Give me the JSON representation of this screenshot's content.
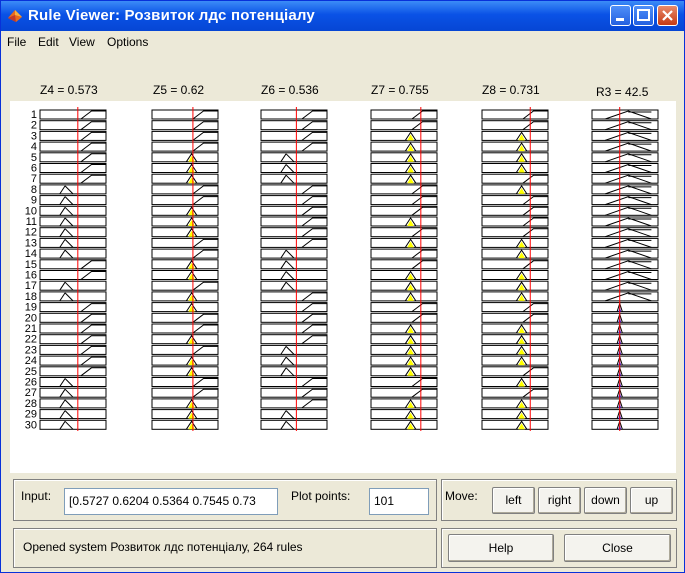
{
  "window": {
    "title": "Rule Viewer: Розвиток лдс потенціалу",
    "accent": "#0a52e6"
  },
  "menu": {
    "items": [
      "File",
      "Edit",
      "View",
      "Options"
    ]
  },
  "variables": [
    {
      "label": "Z4 = 0.573",
      "value": 0.573
    },
    {
      "label": "Z5 = 0.62",
      "value": 0.62
    },
    {
      "label": "Z6 = 0.536",
      "value": 0.536
    },
    {
      "label": "Z7 = 0.755",
      "value": 0.755
    },
    {
      "label": "Z8 = 0.731",
      "value": 0.731
    },
    {
      "label": "R3 = 42.5",
      "value": 42.5
    }
  ],
  "rule_numbers": [
    "1",
    "2",
    "3",
    "4",
    "5",
    "6",
    "7",
    "8",
    "9",
    "10",
    "11",
    "12",
    "13",
    "14",
    "15",
    "16",
    "17",
    "18",
    "19",
    "20",
    "21",
    "22",
    "23",
    "24",
    "25",
    "26",
    "27",
    "28",
    "29",
    "30"
  ],
  "rules": {
    "comment": "membership function per cell: R=ramp-right, L=ramp-left, T=triangle, N=narrow-triangle, W=wide-triangle",
    "Z4": [
      "R",
      "R",
      "R",
      "R",
      "R",
      "R",
      "R",
      "L",
      "L",
      "L",
      "L",
      "L",
      "L",
      "L",
      "R",
      "R",
      "L",
      "L",
      "R",
      "R",
      "R",
      "R",
      "R",
      "R",
      "R",
      "L",
      "L",
      "L",
      "L",
      "L"
    ],
    "Z5": [
      "R",
      "R",
      "R",
      "R",
      "T",
      "T",
      "T",
      "R",
      "R",
      "T",
      "T",
      "T",
      "R",
      "R",
      "T",
      "T",
      "R",
      "T",
      "T",
      "R",
      "R",
      "T",
      "R",
      "T",
      "T",
      "R",
      "R",
      "T",
      "T",
      "T"
    ],
    "Z6": [
      "R",
      "R",
      "R",
      "R",
      "L",
      "L",
      "L",
      "R",
      "R",
      "R",
      "R",
      "R",
      "R",
      "L",
      "L",
      "L",
      "L",
      "R",
      "R",
      "R",
      "R",
      "R",
      "L",
      "L",
      "L",
      "R",
      "R",
      "R",
      "L",
      "L"
    ],
    "Z7": [
      "R",
      "R",
      "T",
      "T",
      "T",
      "T",
      "T",
      "R",
      "R",
      "R",
      "T",
      "R",
      "T",
      "R",
      "R",
      "T",
      "T",
      "T",
      "R",
      "R",
      "T",
      "T",
      "T",
      "T",
      "T",
      "R",
      "R",
      "T",
      "T",
      "T"
    ],
    "Z8": [
      "R",
      "R",
      "T",
      "T",
      "T",
      "T",
      "R",
      "T",
      "R",
      "R",
      "R",
      "R",
      "T",
      "T",
      "R",
      "T",
      "T",
      "T",
      "R",
      "R",
      "T",
      "T",
      "T",
      "T",
      "R",
      "T",
      "R",
      "T",
      "T",
      "T"
    ],
    "R3": [
      "W",
      "W",
      "W",
      "W",
      "W",
      "W",
      "W",
      "W",
      "W",
      "W",
      "W",
      "W",
      "W",
      "W",
      "W",
      "W",
      "W",
      "W",
      "N",
      "N",
      "N",
      "N",
      "N",
      "N",
      "N",
      "N",
      "N",
      "N",
      "N",
      "N"
    ]
  },
  "controls": {
    "input_label": "Input:",
    "input_value": "[0.5727 0.6204 0.5364 0.7545 0.73",
    "plot_points_label": "Plot points:",
    "plot_points_value": "101",
    "move_label": "Move:",
    "move_left": "left",
    "move_right": "right",
    "move_down": "down",
    "move_up": "up",
    "help": "Help",
    "close": "Close"
  },
  "status": {
    "text": "Opened system Розвиток лдс потенціалу, 264 rules"
  }
}
